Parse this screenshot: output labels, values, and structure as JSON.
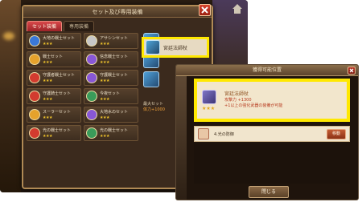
{
  "shot1": {
    "dialog_title": "セット及び専用装備",
    "tabs": [
      {
        "label": "セット装備",
        "active": true
      },
      {
        "label": "専用装備",
        "active": false
      }
    ],
    "items": [
      {
        "name": "大地の戦士セット",
        "stars": "★★★",
        "gem_color": "#3a78d8"
      },
      {
        "name": "アサシンセット",
        "stars": "★★★",
        "gem_color": "#c7c7c7"
      },
      {
        "name": "戦士セット",
        "stars": "★★★",
        "gem_color": "#e5a22c"
      },
      {
        "name": "信念戦士セット",
        "stars": "★★★",
        "gem_color": "#8857d6"
      },
      {
        "name": "守護者戦士セット",
        "stars": "★★★",
        "gem_color": "#d23b2f"
      },
      {
        "name": "守護戦士セット",
        "stars": "★★★",
        "gem_color": "#8857d6"
      },
      {
        "name": "守護騎士セット",
        "stars": "★★★",
        "gem_color": "#d23b2f"
      },
      {
        "name": "今夜セット",
        "stars": "★★★",
        "gem_color": "#3a9b5a"
      },
      {
        "name": "スーラーセット",
        "stars": "★★★",
        "gem_color": "#e5a22c"
      },
      {
        "name": "大地水のセット",
        "stars": "★★★",
        "gem_color": "#8857d6"
      },
      {
        "name": "光の戦士セット",
        "stars": "★★★",
        "gem_color": "#d23b2f"
      },
      {
        "name": "光の戦士セット",
        "stars": "★★★",
        "gem_color": "#3a9b5a"
      }
    ],
    "highlight_label": "宮廷法師杖",
    "stat_line1": "最大セット",
    "stat_line2": "体力+1000"
  },
  "shot2": {
    "title": "獲得可能位置",
    "item": {
      "name": "宮廷法師杖",
      "stars": "★★★",
      "stat": "攻撃力 +1300",
      "desc": "+1以上の強化武器の装備が可能"
    },
    "location": "4.光の防御",
    "move_button": "移動",
    "close_button": "閉じる"
  }
}
